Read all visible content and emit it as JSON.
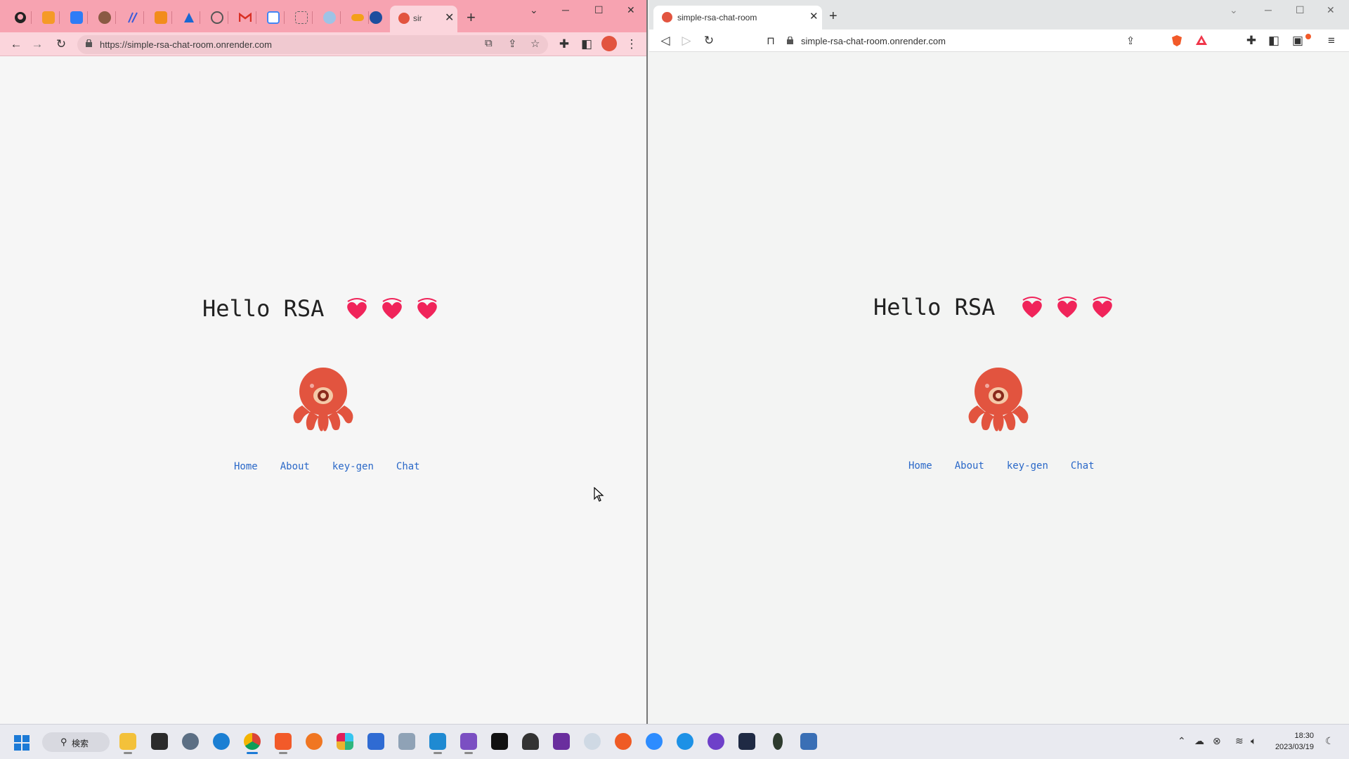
{
  "left_browser": {
    "active_tab_title": "sir",
    "url": "https://simple-rsa-chat-room.onrender.com",
    "pinned_tabs": [
      "github-icon",
      "gitlab-icon",
      "jira-icon",
      "circle-app-icon",
      "slash-app-icon",
      "box-icon",
      "azure-icon",
      "chatgpt-icon",
      "gmail-icon",
      "calendar-icon",
      "tab-blank-icon",
      "clock-app-icon",
      "infinity-icon",
      "cloud-app-icon"
    ]
  },
  "right_browser": {
    "active_tab_title": "simple-rsa-chat-room",
    "url": "simple-rsa-chat-room.onrender.com"
  },
  "page": {
    "greeting": "Hello RSA",
    "nav": {
      "home": "Home",
      "about": "About",
      "keygen": "key-gen",
      "chat": "Chat"
    }
  },
  "taskbar": {
    "search_label": "検索",
    "time": "18:30",
    "date": "2023/03/19"
  },
  "colors": {
    "left_tabstrip": "#f7a3b1",
    "link": "#2a68c8",
    "octopus": "#e2543f",
    "heart": "#f0245a"
  }
}
